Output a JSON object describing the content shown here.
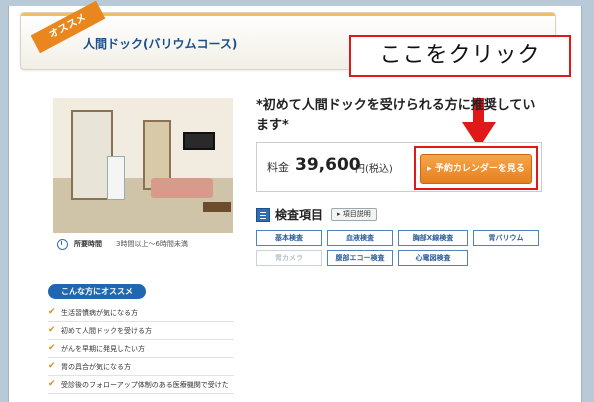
{
  "header": {
    "ribbon": "オススメ",
    "title": "人間ドック(バリウムコース)"
  },
  "callout": {
    "text": "ここをクリック",
    "color": "#e01818"
  },
  "photo": {
    "duration_label": "所要時間",
    "duration_value": "3時間以上〜6時間未満"
  },
  "detail": {
    "tagline": "*初めて人間ドックを受けられる方に推奨しています*",
    "price_label": "料金",
    "price_value": "39,600",
    "price_unit": "円(税込)",
    "calendar_button": "▸ 予約カレンダーを見る",
    "accent": "#e5801e"
  },
  "exams": {
    "title": "検査項目",
    "detail_button": "▸ 項目説明",
    "items": [
      {
        "label": "基本検査",
        "active": true
      },
      {
        "label": "血液検査",
        "active": true
      },
      {
        "label": "胸部X線検査",
        "active": true
      },
      {
        "label": "胃バリウム",
        "active": true
      },
      {
        "label": "胃カメラ",
        "active": false
      },
      {
        "label": "腹部エコー検査",
        "active": true
      },
      {
        "label": "心電図検査",
        "active": true
      }
    ]
  },
  "recommend": {
    "badge": "こんな方にオススメ",
    "items": [
      "生活習慣病が気になる方",
      "初めて人間ドックを受ける方",
      "がんを早期に発見したい方",
      "胃の具合が気になる方",
      "受診後のフォローアップ体制のある医療機関で受けた"
    ]
  }
}
